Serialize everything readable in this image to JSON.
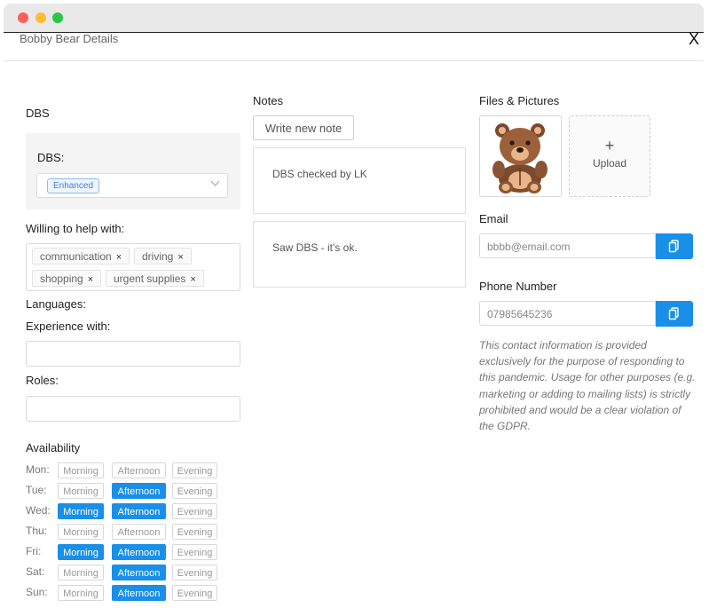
{
  "modal": {
    "title": "Bobby Bear Details",
    "close_glyph": "X"
  },
  "dbs": {
    "section_title": "DBS",
    "field_label": "DBS:",
    "selected_tag": "Enhanced"
  },
  "willing": {
    "label": "Willing to help with:",
    "tags": [
      "communication",
      "driving",
      "shopping",
      "urgent supplies"
    ],
    "remove_glyph": "×"
  },
  "languages": {
    "label": "Languages:"
  },
  "experience": {
    "label": "Experience with:",
    "value": ""
  },
  "roles": {
    "label": "Roles:",
    "value": ""
  },
  "availability": {
    "title": "Availability",
    "slots": [
      "Morning",
      "Afternoon",
      "Evening"
    ],
    "days": [
      {
        "label": "Mon:",
        "selected": [
          false,
          false,
          false
        ]
      },
      {
        "label": "Tue:",
        "selected": [
          false,
          true,
          false
        ]
      },
      {
        "label": "Wed:",
        "selected": [
          true,
          true,
          false
        ]
      },
      {
        "label": "Thu:",
        "selected": [
          false,
          false,
          false
        ]
      },
      {
        "label": "Fri:",
        "selected": [
          true,
          true,
          false
        ]
      },
      {
        "label": "Sat:",
        "selected": [
          false,
          true,
          false
        ]
      },
      {
        "label": "Sun:",
        "selected": [
          false,
          true,
          false
        ]
      }
    ],
    "selected_color": "#1a8fe8"
  },
  "notes": {
    "title": "Notes",
    "new_note_label": "Write new note",
    "items": [
      "DBS checked by LK",
      "Saw DBS - it's ok."
    ]
  },
  "files": {
    "title": "Files & Pictures",
    "upload_plus": "+",
    "upload_label": "Upload"
  },
  "email": {
    "label": "Email",
    "placeholder": "bbbb@email.com"
  },
  "phone": {
    "label": "Phone Number",
    "placeholder": "07985645236"
  },
  "disclaimer": "This contact information is provided exclusively for the purpose of responding to this pandemic. Usage for other purposes (e.g. marketing or adding to mailing lists) is strictly prohibited and would be a clear violation of the GDPR.",
  "icons": {
    "close": "close-icon",
    "chevron": "chevron-down-icon",
    "copy": "copy-icon",
    "remove": "remove-icon"
  },
  "colors": {
    "accent": "#1a8fe8",
    "tag_text": "#3b82d9"
  }
}
